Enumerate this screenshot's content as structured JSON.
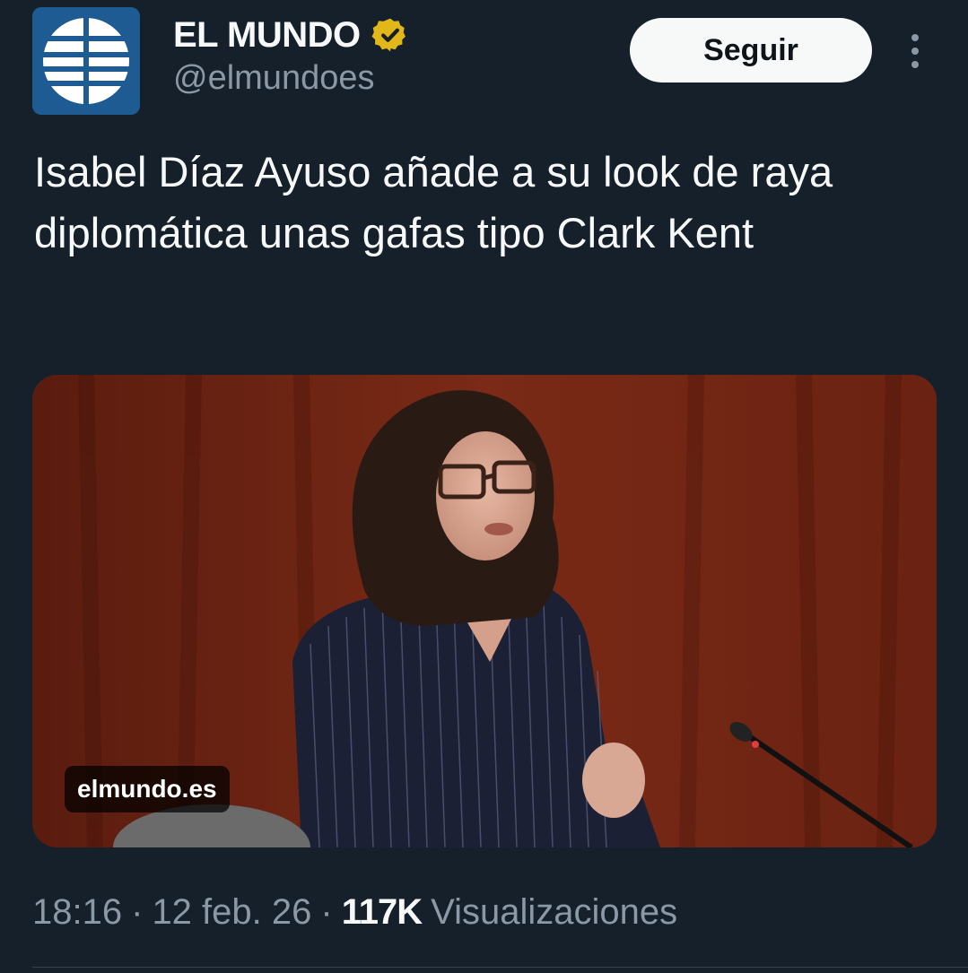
{
  "author": {
    "display_name": "EL MUNDO",
    "handle": "@elmundoes",
    "verified": true,
    "avatar_icon": "el-mundo-globe-logo"
  },
  "follow_label": "Seguir",
  "more_icon": "more-vertical-icon",
  "tweet_text": "Isabel Díaz Ayuso añade a su look de raya diplomática unas gafas tipo Clark Kent",
  "media": {
    "source": "elmundo.es"
  },
  "meta": {
    "time": "18:16",
    "sep1": "·",
    "date": "12 feb. 26",
    "sep2": "·",
    "views_count": "117K",
    "views_label": "Visualizaciones"
  },
  "colors": {
    "background": "#15202b",
    "text_primary": "#f7f9f9",
    "text_secondary": "#8b98a5",
    "verified_badge": "#e2b719",
    "logo_blue": "#1f5b93"
  }
}
